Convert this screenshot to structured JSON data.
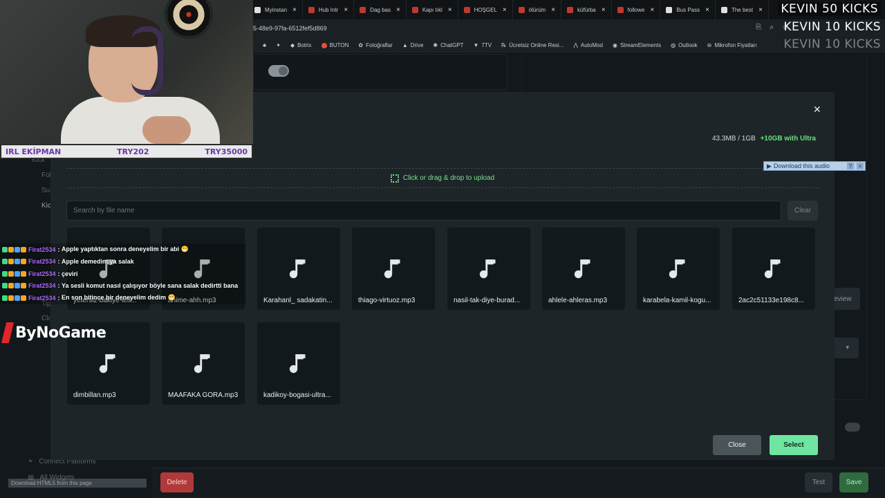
{
  "browser": {
    "tabs": [
      {
        "label": "Myinstan"
      },
      {
        "label": "Hub Intr"
      },
      {
        "label": "Dag bas"
      },
      {
        "label": "Kapı tıkl"
      },
      {
        "label": "HOŞGEL"
      },
      {
        "label": "ölürüm"
      },
      {
        "label": "küfürba"
      },
      {
        "label": "followe"
      },
      {
        "label": "Bus Pass"
      },
      {
        "label": "The best"
      }
    ],
    "url": "5-48e9-97fa-6512fef5d869",
    "bookmarks": [
      {
        "label": "Botrix"
      },
      {
        "label": "BUTON"
      },
      {
        "label": "Fotoğraflar"
      },
      {
        "label": "Drive"
      },
      {
        "label": "ChatGPT"
      },
      {
        "label": "7TV"
      },
      {
        "label": "Ücretsiz Online Resi..."
      },
      {
        "label": "AutoMod"
      },
      {
        "label": "StreamElements"
      },
      {
        "label": "Outlook"
      },
      {
        "label": "Mikrofon Fiyatları"
      }
    ]
  },
  "overlay": {
    "kicks_line1": "KEVIN  50 KICKS",
    "kicks_line2": "KEVIN  10 KICKS",
    "kicks_line3": "KEVIN  10 KICKS",
    "cam_left": "IRL EKİPMAN",
    "cam_mid": "TRY202",
    "cam_right": "TRY35000",
    "brand": "ByNoGame",
    "download_audio": "Download this audio",
    "download_html5": "Download HTML5 from this page"
  },
  "chat": [
    {
      "user": "Firat2534",
      "message": "Apple yaptıktan sonra deneyelim bir abi 😁"
    },
    {
      "user": "Firat2534",
      "message": "Apple demedim ya salak"
    },
    {
      "user": "Firat2534",
      "message": "çeviri"
    },
    {
      "user": "Firat2534",
      "message": "Ya sesli komut nasıl çalışıyor böyle sana salak dedirtti bana"
    },
    {
      "user": "Firat2534",
      "message": "En son bitince bir deneyelim dedim 😁"
    }
  ],
  "sidebar": {
    "kick": "Kick",
    "fol": "Fol",
    "sub": "Sub",
    "kic": "Kic",
    "tips": "Tip",
    "clo": "Clo",
    "connect": "Connect Platforms",
    "all_widgets": "All Widgets"
  },
  "background": {
    "review": "eview",
    "delete": "Delete",
    "test": "Test",
    "save": "Save"
  },
  "modal": {
    "storage_used": "43.3MB / 1GB",
    "storage_upgrade": "+10GB with Ultra",
    "upload_label": "Click or drag & drop to upload",
    "search_placeholder": "Search by file name",
    "clear_label": "Clear",
    "close_label": "Close",
    "select_label": "Select",
    "files": [
      {
        "name": "yetersiz-bakiye-iett..."
      },
      {
        "name": "anime-ahh.mp3"
      },
      {
        "name": "Karahanl_ sadakatin..."
      },
      {
        "name": "thiago-virtuoz.mp3"
      },
      {
        "name": "nasil-tak-diye-burad..."
      },
      {
        "name": "ahlele-ahleras.mp3"
      },
      {
        "name": "karabela-kamil-kogu..."
      },
      {
        "name": "2ac2c51133e198c8..."
      },
      {
        "name": "dimbillan.mp3"
      },
      {
        "name": "MAAFAKA GORA.mp3"
      },
      {
        "name": "kadikoy-bogasi-ultra..."
      }
    ]
  },
  "colors": {
    "accent": "#6ee6a1",
    "upgrade": "#6ee07a",
    "danger": "#b03a3a",
    "chat_user": "#b06aff"
  }
}
